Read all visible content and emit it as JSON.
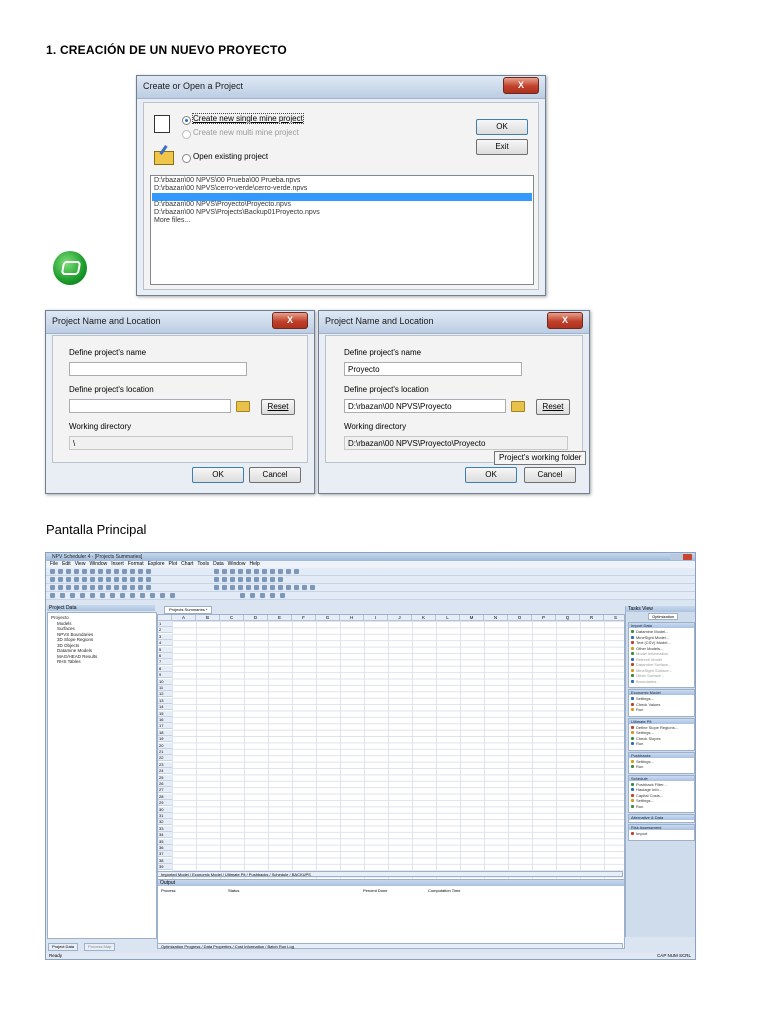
{
  "heading": "1.   CREACIÓN DE UN NUEVO PROYECTO",
  "subtitle": "Pantalla Principal",
  "dialog_open": {
    "title": "Create or Open a Project",
    "close": "X",
    "option_single": "Create new single mine project",
    "option_multi": "Create new multi mine project",
    "option_open": "Open existing project",
    "ok": "OK",
    "exit": "Exit",
    "recent": [
      "D:\\rbazan\\00 NPVS\\00 Prueba\\00 Prueba.npvs",
      "D:\\rbazan\\00 NPVS\\cerro-verde\\cerro-verde.npvs",
      "",
      "D:\\rbazan\\00 NPVS\\Proyecto\\Proyecto.npvs",
      "D:\\rbazan\\00 NPVS\\Projects\\Backup01Proyecto.npvs",
      "More files..."
    ]
  },
  "dialog_name_empty": {
    "title": "Project Name and Location",
    "close": "X",
    "name_label": "Define project's name",
    "name_value": "",
    "location_label": "Define project's location",
    "location_value": "",
    "reset": "Reset",
    "working_label": "Working directory",
    "working_value": "\\",
    "ok": "OK",
    "cancel": "Cancel"
  },
  "dialog_name_filled": {
    "title": "Project Name and Location",
    "close": "X",
    "name_label": "Define project's name",
    "name_value": "Proyecto",
    "location_label": "Define project's location",
    "location_value": "D:\\rbazan\\00 NPVS\\Proyecto",
    "reset": "Reset",
    "working_label": "Working directory",
    "working_value": "D:\\rbazan\\00 NPVS\\Proyecto\\Proyecto",
    "tooltip": "Project's working folder",
    "ok": "OK",
    "cancel": "Cancel"
  },
  "app": {
    "title": "NPV Scheduler 4 - [Projects Summaries]",
    "menu": [
      "File",
      "Edit",
      "View",
      "Window",
      "Insert",
      "Format",
      "Explore",
      "Plot",
      "Chart",
      "Tools",
      "Data",
      "Window",
      "Help"
    ],
    "left_pane_title": "Project Data",
    "tree": [
      "Proyecto",
      "Models",
      "Surfaces",
      "NPVS Boundaries",
      "3D Slope Regions",
      "3D Objects",
      "Datamine Models",
      "MAG/HEAD Results",
      "RHS Tables"
    ],
    "doc_tab": "Projects Summaries *",
    "columns": [
      "A",
      "B",
      "C",
      "D",
      "E",
      "F",
      "G",
      "H",
      "I",
      "J",
      "K",
      "L",
      "M",
      "N",
      "O",
      "P",
      "Q",
      "R",
      "S"
    ],
    "rows": [
      "1",
      "2",
      "3",
      "4",
      "5",
      "6",
      "7",
      "8",
      "9",
      "10",
      "11",
      "12",
      "13",
      "14",
      "15",
      "16",
      "17",
      "18",
      "19",
      "20",
      "21",
      "22",
      "23",
      "24",
      "25",
      "26",
      "27",
      "28",
      "29",
      "30",
      "31",
      "32",
      "33",
      "34",
      "35",
      "36",
      "37",
      "38",
      "39"
    ],
    "sheet_tabs": "Imported Model / Economic Model / Ultimate Pit / Pushbacks / Schedule / BACKUPS",
    "output_title": "Output",
    "output_cols": [
      "Process",
      "Status",
      "Percent Done",
      "Computation Time"
    ],
    "bottom_tabs": "Optimization Progress / Data Properties / Cost Information / Batch Run Log",
    "left_tabs": [
      "Project Data",
      "Process Map"
    ],
    "status": "Ready",
    "status_right": "CAP NUM SCRL",
    "task_title": "Tasks View",
    "task_tab": "Optimization",
    "sections": [
      {
        "title": "Import Data",
        "items": [
          "Datamine Model...",
          "MineSight Model...",
          "Text (CSV) Model...",
          "Other Models...",
          "Model Information",
          "Refresh Model",
          "Datamine Surface...",
          "MineSight Surface...",
          "Other Surface...",
          "Boundaries..."
        ]
      },
      {
        "title": "Economic Model",
        "items": [
          "Settings...",
          "Check Values",
          "Run"
        ]
      },
      {
        "title": "Ultimate Pit",
        "items": [
          "Define Slope Regions...",
          "Settings...",
          "Check Slopes",
          "Run"
        ]
      },
      {
        "title": "Pushbacks",
        "items": [
          "Settings...",
          "Run"
        ]
      },
      {
        "title": "Schedule",
        "items": [
          "Pushback Filter...",
          "Haulage Info...",
          "Capital Costs...",
          "Settings...",
          "Run"
        ]
      },
      {
        "title": "Alternative & Data",
        "items": []
      },
      {
        "title": "Risk Assessment",
        "items": [
          "Import"
        ]
      }
    ]
  },
  "colors": {
    "selection": "#3399ff",
    "close": "#c0412a",
    "accent": "#2a6bc8"
  }
}
